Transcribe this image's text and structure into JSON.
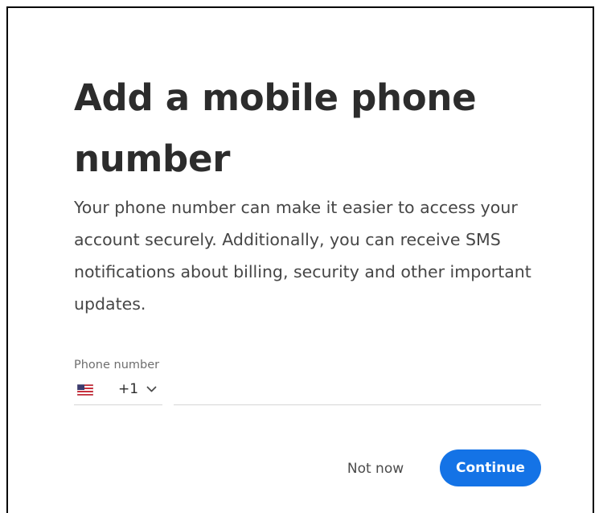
{
  "dialog": {
    "title": "Add a mobile phone number",
    "description": "Your phone number can make it easier to access your account securely. Additionally, you can receive SMS notifications about billing, security and other important updates."
  },
  "phone_field": {
    "label": "Phone number",
    "country_flag": "us-flag-icon",
    "dial_code": "+1",
    "value": "",
    "placeholder": ""
  },
  "actions": {
    "secondary_label": "Not now",
    "primary_label": "Continue"
  },
  "colors": {
    "primary": "#1473e6",
    "title_text": "#2c2c2c",
    "body_text": "#464646",
    "label_text": "#6e6e6e",
    "divider": "#d5d5d5"
  }
}
